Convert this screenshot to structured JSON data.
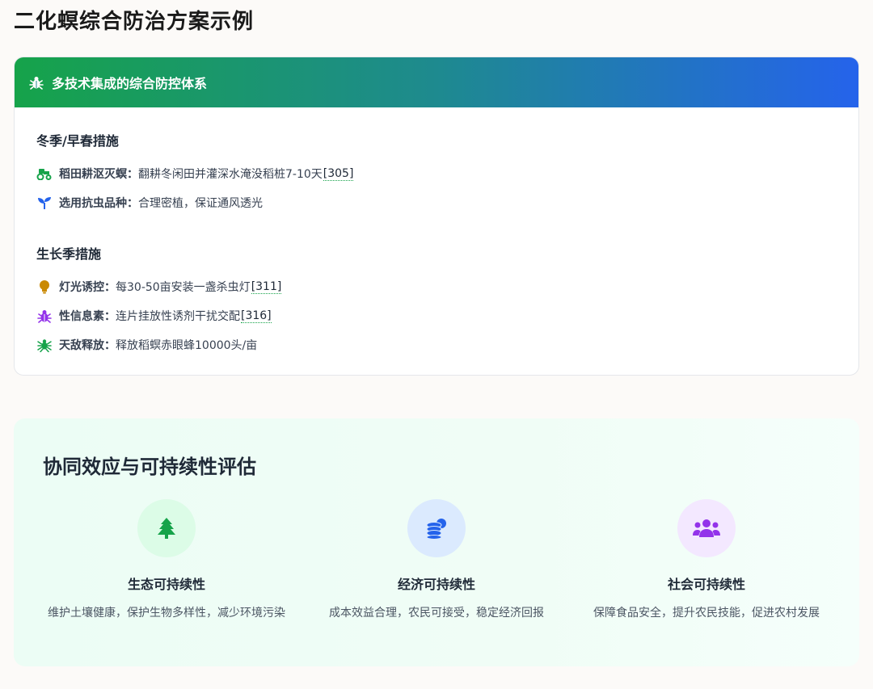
{
  "page": {
    "title": "二化螟综合防治方案示例"
  },
  "card": {
    "header_title": "多技术集成的综合防控体系",
    "sections": [
      {
        "title": "冬季/早春措施",
        "items": [
          {
            "icon": "tractor-icon",
            "label": "稻田耕沤灭螟：",
            "text": "翻耕冬闲田并灌深水淹没稻桩7-10天",
            "cite": "[305]",
            "color": "#16a34a"
          },
          {
            "icon": "seedling-icon",
            "label": "选用抗虫品种：",
            "text": "合理密植，保证通风透光",
            "cite": "",
            "color": "#2563eb"
          }
        ]
      },
      {
        "title": "生长季措施",
        "items": [
          {
            "icon": "lightbulb-icon",
            "label": "灯光诱控：",
            "text": "每30-50亩安装一盏杀虫灯",
            "cite": "[311]",
            "color": "#ca8a04"
          },
          {
            "icon": "bug-icon",
            "label": "性信息素：",
            "text": "连片挂放性诱剂干扰交配",
            "cite": "[316]",
            "color": "#9333ea"
          },
          {
            "icon": "spider-icon",
            "label": "天敌释放：",
            "text": "释放稻螟赤眼蜂10000头/亩",
            "cite": "",
            "color": "#16a34a"
          }
        ]
      }
    ]
  },
  "panel": {
    "title": "协同效应与可持续性评估",
    "columns": [
      {
        "icon": "tree-icon",
        "title": "生态可持续性",
        "desc": "维护土壤健康，保护生物多样性，减少环境污染",
        "color": "#16a34a",
        "bg": "#dcfce7"
      },
      {
        "icon": "coins-icon",
        "title": "经济可持续性",
        "desc": "成本效益合理，农民可接受，稳定经济回报",
        "color": "#2563eb",
        "bg": "#dbeafe"
      },
      {
        "icon": "users-icon",
        "title": "社会可持续性",
        "desc": "保障食品安全，提升农民技能，促进农村发展",
        "color": "#9333ea",
        "bg": "#f3e8ff"
      }
    ]
  }
}
